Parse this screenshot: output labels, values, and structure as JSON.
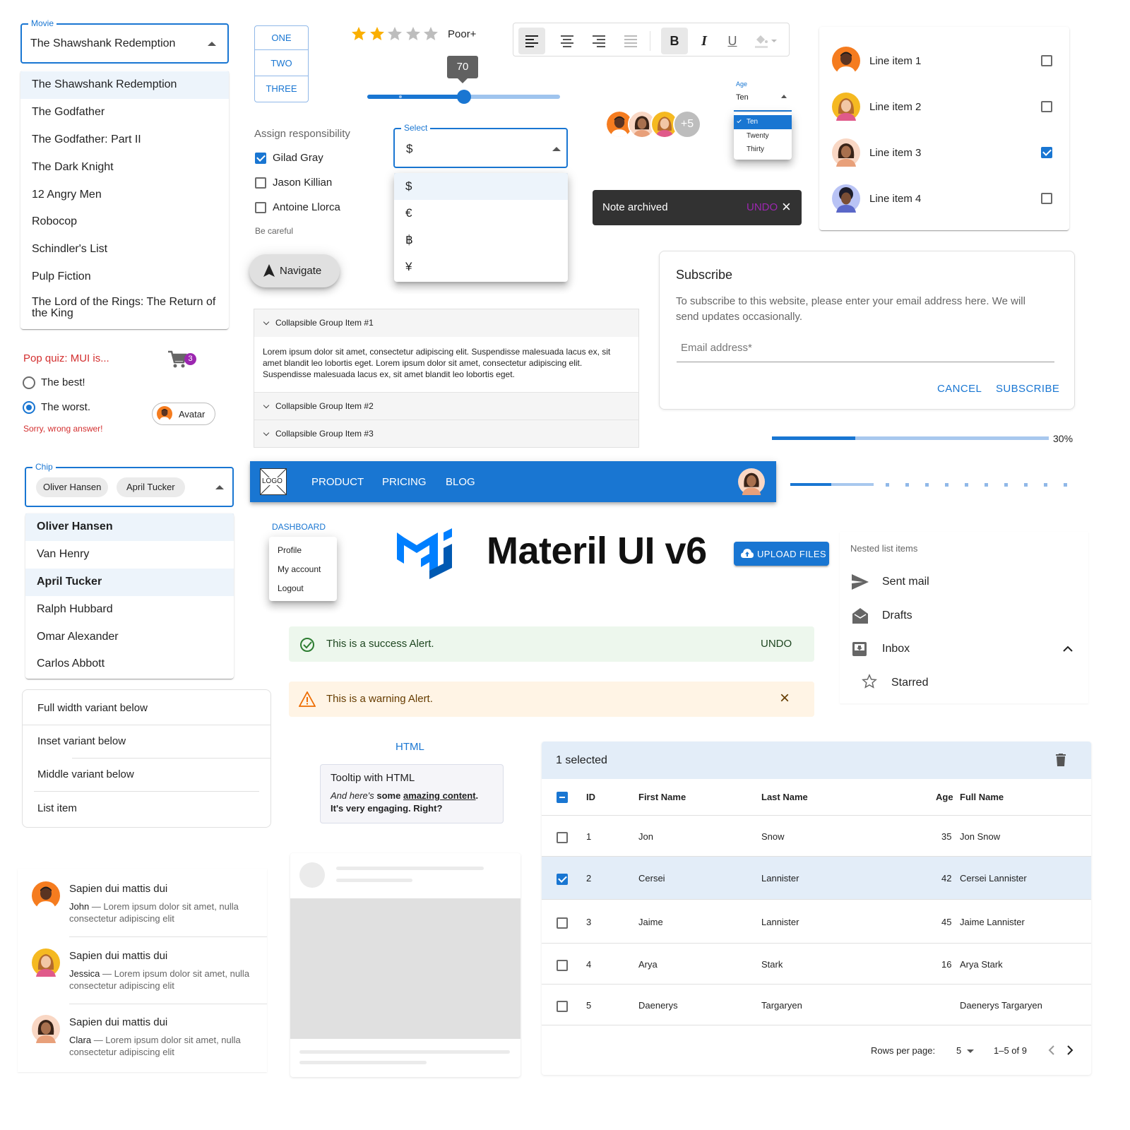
{
  "movie": {
    "label": "Movie",
    "value": "The Shawshank Redemption",
    "options": [
      "The Shawshank Redemption",
      "The Godfather",
      "The Godfather: Part II",
      "The Dark Knight",
      "12 Angry Men",
      "Robocop",
      "Schindler's List",
      "Pulp Fiction",
      "The Lord of the Rings: The Return of the King"
    ]
  },
  "button_group": [
    "ONE",
    "TWO",
    "THREE"
  ],
  "rating": {
    "value": 2,
    "max": 5,
    "label": "Poor+"
  },
  "slider": {
    "value": 70,
    "value_label": "70"
  },
  "toolbar": {
    "icons": [
      "align-left-icon",
      "align-center-icon",
      "align-right-icon",
      "align-justify-icon",
      "bold-icon",
      "italic-icon",
      "underline-icon",
      "fill-color-icon"
    ]
  },
  "line_items": {
    "items": [
      {
        "label": "Line item 1",
        "checked": false
      },
      {
        "label": "Line item 2",
        "checked": false
      },
      {
        "label": "Line item 3",
        "checked": true
      },
      {
        "label": "Line item 4",
        "checked": false
      }
    ]
  },
  "assign": {
    "legend": "Assign responsibility",
    "options": [
      {
        "label": "Gilad Gray",
        "checked": true
      },
      {
        "label": "Jason Killian",
        "checked": false
      },
      {
        "label": "Antoine Llorca",
        "checked": false
      }
    ],
    "helper": "Be careful"
  },
  "currency": {
    "label": "Select",
    "value": "$",
    "options": [
      "$",
      "€",
      "฿",
      "¥"
    ]
  },
  "avatar_group": {
    "surplus": "+5"
  },
  "age": {
    "label": "Age",
    "value": "Ten",
    "options": [
      "Ten",
      "Twenty",
      "Thirty"
    ]
  },
  "snackbar": {
    "message": "Note archived",
    "action": "UNDO"
  },
  "fab": {
    "label": "Navigate"
  },
  "subscribe": {
    "title": "Subscribe",
    "text": "To subscribe to this website, please enter your email address here. We will send updates occasionally.",
    "placeholder": "Email address*",
    "cancel": "CANCEL",
    "submit": "SUBSCRIBE"
  },
  "accordion": {
    "items": [
      "Collapsible Group Item #1",
      "Collapsible Group Item #2",
      "Collapsible Group Item #3"
    ],
    "content": "Lorem ipsum dolor sit amet, consectetur adipiscing elit. Suspendisse malesuada lacus ex, sit amet blandit leo lobortis eget. Lorem ipsum dolor sit amet, consectetur adipiscing elit. Suspendisse malesuada lacus ex, sit amet blandit leo lobortis eget."
  },
  "quiz": {
    "legend": "Pop quiz: MUI is...",
    "options": [
      {
        "label": "The best!",
        "selected": false
      },
      {
        "label": "The worst.",
        "selected": true
      }
    ],
    "error": "Sorry, wrong answer!"
  },
  "cart": {
    "badge": "3"
  },
  "avatar_chip": {
    "label": "Avatar"
  },
  "progress": {
    "value": 0.3,
    "label": "30%"
  },
  "appbar": {
    "logo": "LOGO",
    "links": [
      "PRODUCT",
      "PRICING",
      "BLOG"
    ]
  },
  "chip_select": {
    "label": "Chip",
    "chips": [
      "Oliver Hansen",
      "April Tucker"
    ],
    "options": [
      {
        "label": "Oliver Hansen",
        "selected": true
      },
      {
        "label": "Van Henry",
        "selected": false
      },
      {
        "label": "April Tucker",
        "selected": true
      },
      {
        "label": "Ralph Hubbard",
        "selected": false
      },
      {
        "label": "Omar Alexander",
        "selected": false
      },
      {
        "label": "Carlos Abbott",
        "selected": false
      }
    ]
  },
  "dashboard": {
    "button": "DASHBOARD",
    "menu": [
      "Profile",
      "My account",
      "Logout"
    ]
  },
  "hero": {
    "title": "Materil UI v6"
  },
  "upload": {
    "label": "UPLOAD FILES"
  },
  "nested_list": {
    "subheader": "Nested list items",
    "items": [
      {
        "label": "Sent mail",
        "icon": "send-icon"
      },
      {
        "label": "Drafts",
        "icon": "drafts-icon"
      },
      {
        "label": "Inbox",
        "icon": "inbox-icon"
      }
    ],
    "sub_item": {
      "label": "Starred",
      "icon": "star-outline-icon"
    }
  },
  "alerts": {
    "success": {
      "message": "This is a success Alert.",
      "action": "UNDO",
      "color": "#2e7d32"
    },
    "warning": {
      "message": "This is a warning Alert.",
      "color": "#ed6c02"
    }
  },
  "divider_list": [
    "Full width variant below",
    "Inset variant below",
    "Middle variant below",
    "List item"
  ],
  "tooltip": {
    "trigger": "HTML",
    "title": "Tooltip with HTML",
    "em": "And here's",
    "b1": "some",
    "u": "amazing content",
    "b2": ". It's very engaging. Right?"
  },
  "grid": {
    "selected_label": "1 selected",
    "columns": [
      "ID",
      "First Name",
      "Last Name",
      "Age",
      "Full Name"
    ],
    "rows": [
      {
        "id": "1",
        "first": "Jon",
        "last": "Snow",
        "age": "35",
        "full": "Jon Snow",
        "checked": false
      },
      {
        "id": "2",
        "first": "Cersei",
        "last": "Lannister",
        "age": "42",
        "full": "Cersei Lannister",
        "checked": true
      },
      {
        "id": "3",
        "first": "Jaime",
        "last": "Lannister",
        "age": "45",
        "full": "Jaime Lannister",
        "checked": false
      },
      {
        "id": "4",
        "first": "Arya",
        "last": "Stark",
        "age": "16",
        "full": "Arya Stark",
        "checked": false
      },
      {
        "id": "5",
        "first": "Daenerys",
        "last": "Targaryen",
        "age": "",
        "full": "Daenerys Targaryen",
        "checked": false
      }
    ],
    "rows_per_page_label": "Rows per page:",
    "rows_per_page": "5",
    "range": "1–5 of 9"
  },
  "messages": [
    {
      "title": "Sapien dui mattis dui",
      "author": "John",
      "text": " — Lorem ipsum dolor sit amet, nulla consectetur adipiscing elit"
    },
    {
      "title": "Sapien dui mattis dui",
      "author": "Jessica",
      "text": " — Lorem ipsum dolor sit amet, nulla consectetur adipiscing elit"
    },
    {
      "title": "Sapien dui mattis dui",
      "author": "Clara",
      "text": " — Lorem ipsum dolor sit amet, nulla consectetur adipiscing elit"
    }
  ],
  "colors": {
    "primary": "#1976d2",
    "error": "#d32f2f",
    "secondary": "#9c27b0",
    "star": "#faaf00"
  }
}
